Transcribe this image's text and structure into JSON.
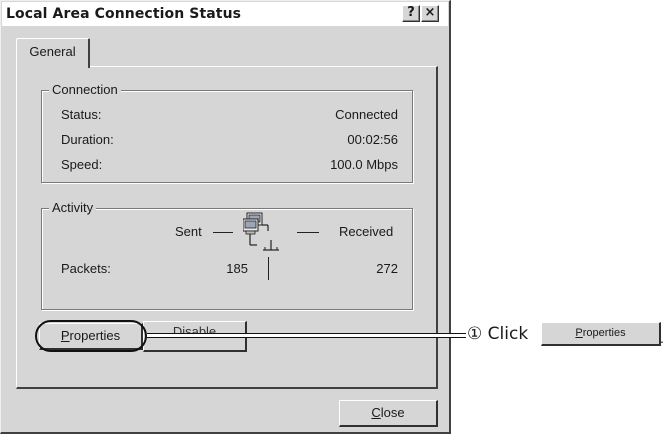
{
  "window": {
    "title": "Local Area Connection Status",
    "help_button": "?",
    "close_button": "×"
  },
  "tabs": [
    {
      "label": "General",
      "selected": true
    }
  ],
  "connection": {
    "group_label": "Connection",
    "rows": [
      {
        "label": "Status:",
        "value": "Connected"
      },
      {
        "label": "Duration:",
        "value": "00:02:56"
      },
      {
        "label": "Speed:",
        "value": "100.0 Mbps"
      }
    ]
  },
  "activity": {
    "group_label": "Activity",
    "sent_label": "Sent",
    "received_label": "Received",
    "packets_label": "Packets:",
    "packets_sent": "185",
    "packets_received": "272"
  },
  "buttons": {
    "properties": {
      "prefix": "",
      "accel": "P",
      "rest": "roperties"
    },
    "disable": {
      "label": "Disable"
    },
    "close": {
      "accel": "C",
      "rest": "lose"
    }
  },
  "annotation": {
    "step": "①",
    "text": "Click",
    "button": {
      "accel": "P",
      "rest": "roperties"
    },
    "suffix": "."
  }
}
